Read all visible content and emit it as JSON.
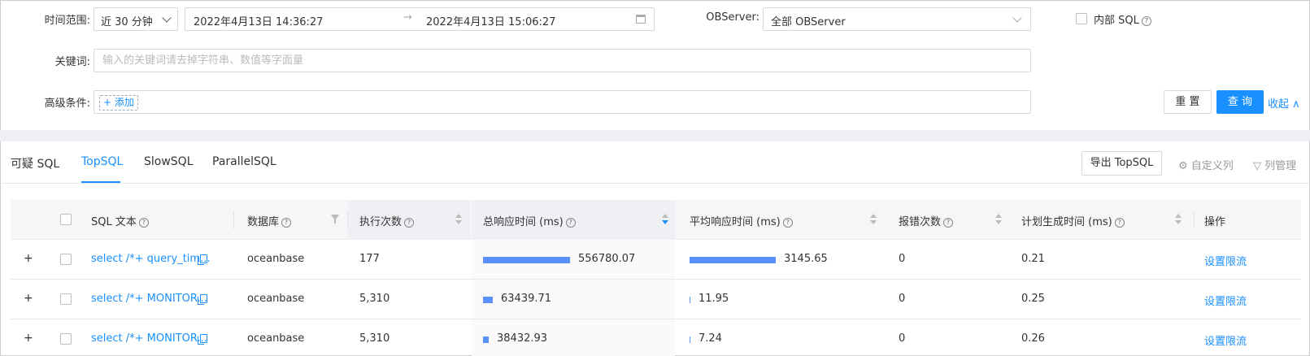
{
  "filters": {
    "time_range_label": "时间范围:",
    "time_range_value": "近 30 分钟",
    "date_start": "2022年4月13日 14:36:27",
    "date_arrow": "→",
    "date_end": "2022年4月13日 15:06:27",
    "observer_label": "OBServer:",
    "observer_value": "全部 OBServer",
    "internal_sql_label": "内部 SQL",
    "keyword_label": "关键词:",
    "keyword_placeholder": "输入的关键词请去掉字符串、数值等字面量",
    "advanced_label": "高级条件:",
    "add_label": "+ 添加",
    "reset_label": "重 置",
    "query_label": "查 询",
    "collapse_label": "收起 ∧"
  },
  "tabs": [
    {
      "label": "可疑 SQL",
      "active": false
    },
    {
      "label": "TopSQL",
      "active": true
    },
    {
      "label": "SlowSQL",
      "active": false
    },
    {
      "label": "ParallelSQL",
      "active": false
    }
  ],
  "toolbar": {
    "export_label": "导出 TopSQL",
    "custom_columns_label": "自定义列",
    "column_manage_label": "列管理"
  },
  "table": {
    "headers": {
      "sql_text": "SQL 文本",
      "database": "数据库",
      "exec_count": "执行次数",
      "total_resp": "总响应时间 (ms)",
      "avg_resp": "平均响应时间 (ms)",
      "error_count": "报错次数",
      "plan_time": "计划生成时间 (ms)",
      "action": "操作"
    },
    "rows": [
      {
        "sql": "select /*+ query_tim...",
        "database": "oceanbase",
        "exec_count": "177",
        "total_resp": "556780.07",
        "total_ratio": 1.0,
        "avg_resp": "3145.65",
        "avg_ratio": 1.0,
        "error_count": "0",
        "plan_time": "0.21",
        "action": "设置限流"
      },
      {
        "sql": "select /*+ MONITOR...",
        "database": "oceanbase",
        "exec_count": "5,310",
        "total_resp": "63439.71",
        "total_ratio": 0.114,
        "avg_resp": "11.95",
        "avg_ratio": 0.0038,
        "error_count": "0",
        "plan_time": "0.25",
        "action": "设置限流"
      },
      {
        "sql": "select /*+ MONITOR...",
        "database": "oceanbase",
        "exec_count": "5,310",
        "total_resp": "38432.93",
        "total_ratio": 0.069,
        "avg_resp": "7.24",
        "avg_ratio": 0.0023,
        "error_count": "0",
        "plan_time": "0.26",
        "action": "设置限流"
      }
    ]
  },
  "colors": {
    "accent": "#1890ff",
    "bar": "#5b8ff9"
  }
}
